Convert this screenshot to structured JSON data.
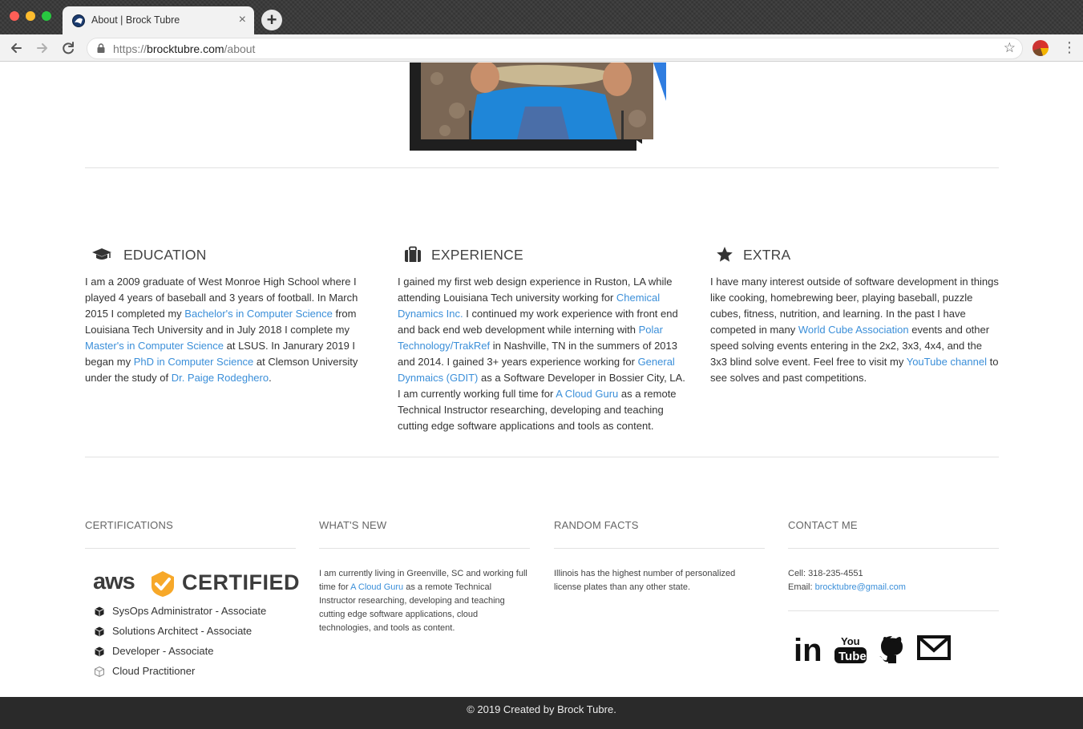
{
  "browser": {
    "tab_title": "About | Brock Tubre",
    "tab_close": "×",
    "new_tab": "+",
    "url_scheme": "https://",
    "url_host": "brocktubre.com",
    "url_path": "/about",
    "icons": {
      "back": "arrow-left-icon",
      "forward": "arrow-right-icon",
      "reload": "reload-icon",
      "lock": "lock-icon",
      "bookmark": "star-icon",
      "menu": "kebab-menu-icon"
    }
  },
  "colors": {
    "link": "#3b8fd9",
    "accent_blue": "#2f7de0",
    "footer_bg": "#2a2a2a",
    "aws_orange": "#f7a829"
  },
  "about": {
    "education": {
      "title": "EDUCATION",
      "icon": "graduation-cap-icon",
      "t1": "I am a 2009 graduate of West Monroe High School where I played 4 years of baseball and 3 years of football. In March 2015 I completed my ",
      "l1": "Bachelor's in Computer Science",
      "t2": " from Louisiana Tech University and in July 2018 I complete my ",
      "l2": "Master's in Computer Science",
      "t3": " at LSUS. In Janurary 2019 I began my ",
      "l3": "PhD in Computer Science",
      "t4": " at Clemson University under the study of ",
      "l4": "Dr. Paige Rodeghero",
      "t5": "."
    },
    "experience": {
      "title": "EXPERIENCE",
      "icon": "briefcase-icon",
      "t1": "I gained my first web design experience in Ruston, LA while attending Louisiana Tech university working for ",
      "l1": "Chemical Dynamics Inc.",
      "t2": " I continued my work experience with front end and back end web development while interning with ",
      "l2": "Polar Technology/TrakRef",
      "t3": " in Nashville, TN in the summers of 2013 and 2014. I gained 3+ years experience working for ",
      "l3": "General Dynmaics (GDIT)",
      "t4": " as a Software Developer in Bossier City, LA. I am currently working full time for ",
      "l4": "A Cloud Guru",
      "t5": " as a remote Technical Instructor researching, developing and teaching cutting edge software applications and tools as content."
    },
    "extra": {
      "title": "EXTRA",
      "icon": "star-icon",
      "t1": "I have many interest outside of software development in things like cooking, homebrewing beer, playing baseball, puzzle cubes, fitness, nutrition, and learning. In the past I have competed in many ",
      "l1": "World Cube Association",
      "t2": " events and other speed solving events entering in the 2x2, 3x3, 4x4, and the 3x3 blind solve event. Feel free to visit my ",
      "l2": "YouTube channel",
      "t3": " to see solves and past competitions."
    }
  },
  "footer_cols": {
    "certifications": {
      "title": "CERTIFICATIONS",
      "aws_word": "aws",
      "aws_certified": "CERTIFIED",
      "items": [
        "SysOps Administrator - Associate",
        "Solutions Architect - Associate",
        "Developer - Associate",
        "Cloud Practitioner"
      ]
    },
    "whats_new": {
      "title": "WHAT'S NEW",
      "t1": "I am currently living in Greenville, SC and working full time for ",
      "l1": "A Cloud Guru",
      "t2": " as a remote Technical Instructor researching, developing and teaching cutting edge software applications, cloud technologies, and tools as content."
    },
    "random_facts": {
      "title": "RANDOM FACTS",
      "text": "Illinois has the highest number of personalized license plates than any other state."
    },
    "contact": {
      "title": "CONTACT ME",
      "cell_label": "Cell: ",
      "cell": "318-235-4551",
      "email_label": "Email: ",
      "email": "brocktubre@gmail.com",
      "socials": [
        "linkedin-icon",
        "youtube-icon",
        "github-icon",
        "email-icon"
      ],
      "linkedin_text": "in",
      "youtube_you": "You",
      "youtube_tube": "Tube"
    }
  },
  "copyright": "© 2019 Created by Brock Tubre."
}
